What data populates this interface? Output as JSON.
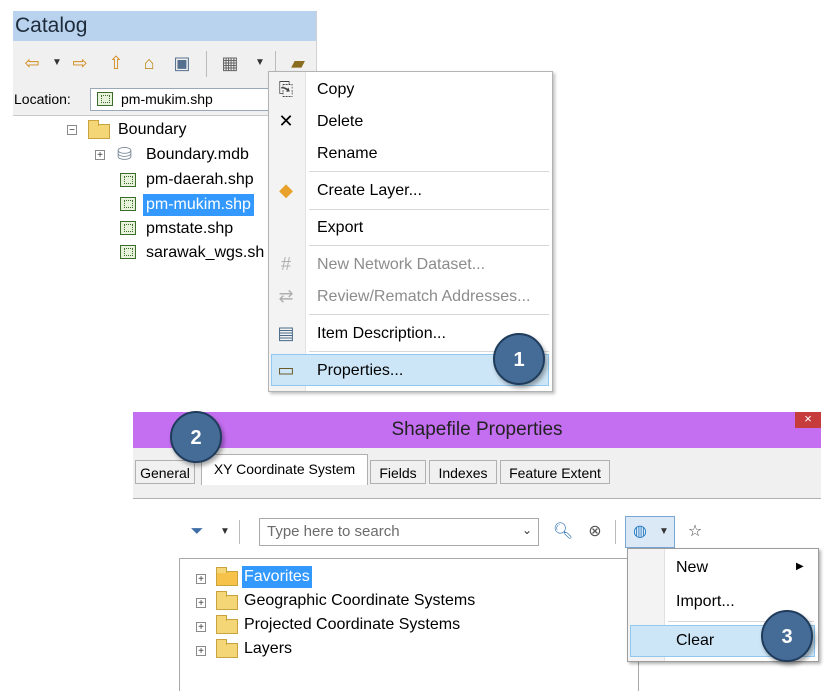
{
  "catalog": {
    "title": "Catalog",
    "location_label": "Location:",
    "location_value": "pm-mukim.shp",
    "tree": [
      {
        "label": "Boundary",
        "type": "folder",
        "expander": "⊟"
      },
      {
        "label": "Boundary.mdb",
        "type": "database",
        "expander": "⊞"
      },
      {
        "label": "pm-daerah.shp",
        "type": "shapefile"
      },
      {
        "label": "pm-mukim.shp",
        "type": "shapefile",
        "selected": true
      },
      {
        "label": "pmstate.shp",
        "type": "shapefile"
      },
      {
        "label": "sarawak_wgs.sh",
        "type": "shapefile"
      }
    ]
  },
  "context_menu": {
    "items": [
      {
        "label": "Copy",
        "icon": "copy-icon"
      },
      {
        "label": "Delete",
        "icon": "delete-x-icon"
      },
      {
        "label": "Rename",
        "icon": ""
      },
      {
        "label": "Create Layer...",
        "icon": "layer-diamond-icon"
      },
      {
        "label": "Export",
        "icon": ""
      },
      {
        "label": "New Network Dataset...",
        "icon": "network-grid-icon",
        "disabled": true
      },
      {
        "label": "Review/Rematch Addresses...",
        "icon": "rematch-icon",
        "disabled": true
      },
      {
        "label": "Item Description...",
        "icon": "document-icon"
      },
      {
        "label": "Properties...",
        "icon": "properties-icon",
        "highlighted": true
      }
    ]
  },
  "badges": {
    "one": "1",
    "two": "2",
    "three": "3"
  },
  "shapefile_properties": {
    "title": "Shapefile Properties",
    "close": "×",
    "tabs": [
      "General",
      "XY Coordinate System",
      "Fields",
      "Indexes",
      "Feature Extent"
    ],
    "active_tab": "XY Coordinate System",
    "search_placeholder": "Type here to search",
    "tree": [
      "Favorites",
      "Geographic Coordinate Systems",
      "Projected Coordinate Systems",
      "Layers"
    ],
    "dropdown": {
      "items": [
        "New",
        "Import...",
        "Clear"
      ],
      "highlighted": "Clear"
    }
  },
  "colors": {
    "catalog_title_bg": "#b9d3ee",
    "props_title_bg": "#c46ff1",
    "selection_bg": "#3399ff",
    "menu_highlight": "#cde6f7",
    "badge": "#456c96"
  }
}
